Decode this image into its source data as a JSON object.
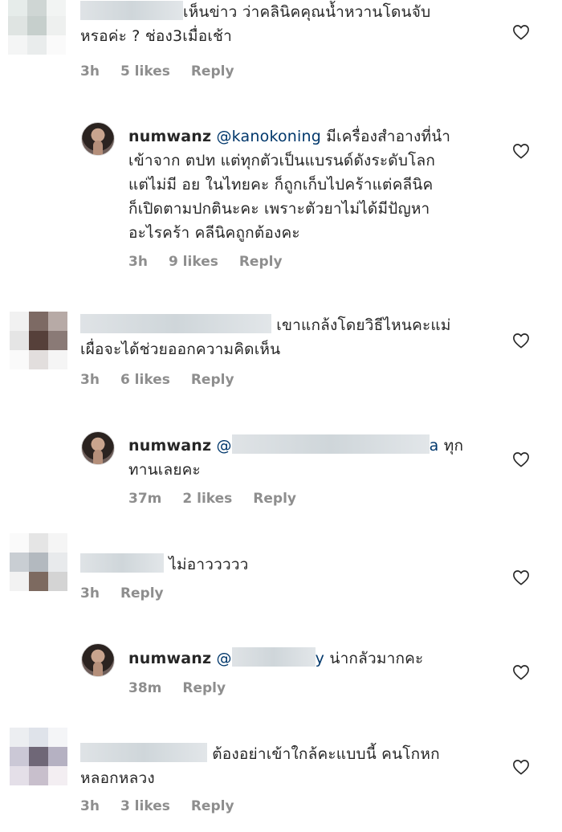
{
  "comments": [
    {
      "text_line1": "เห็นข่าว ว่าคลินิคคุณน้ำหวานโดนจับ",
      "text_line2": "หรอค่ะ ? ช่อง3เมื่อเช้า",
      "time": "3h",
      "likes": "5 likes",
      "reply": "Reply"
    },
    {
      "username": "numwanz",
      "mention": "@kanokoning",
      "text_line1_after_mention": "มีเครื่องสำอางที่นำ",
      "text_line2": "เข้าจาก ตปท แต่ทุกตัวเป็นแบรนด์ดังระดับโลก",
      "text_line3": "แต่ไม่มี อย ในไทยคะ ก็ถูกเก็บไปคร้าแต่คลีนิค",
      "text_line4": "ก็เปิดตามปกตินะคะ เพราะตัวยาไม่ได้มีปัญหา",
      "text_line5": "อะไรคร้า คลีนิคถูกต้องคะ",
      "time": "3h",
      "likes": "9 likes",
      "reply": "Reply"
    },
    {
      "username_partial": "pattawadeeunanttanaka",
      "text_line1": "เขาแกล้งโดยวิธีไหนคะแม่",
      "text_line2": "เผื่อจะได้ช่วยออกความคิดเห็น",
      "time": "3h",
      "likes": "6 likes",
      "reply": "Reply"
    },
    {
      "username": "numwanz",
      "mention_end": "a",
      "text_line1": "ทุก",
      "text_line2": "ทานเลยคะ",
      "time": "37m",
      "likes": "2 likes",
      "reply": "Reply"
    },
    {
      "text_line1": "ไม่อาววววว",
      "time": "3h",
      "reply": "Reply"
    },
    {
      "username": "numwanz",
      "mention_end": "y",
      "text_line1": "น่ากลัวมากคะ",
      "time": "38m",
      "reply": "Reply"
    },
    {
      "text_line1": "ต้องอย่าเข้าใกล้คะแบบนี้ คนโกหก",
      "text_line2": "หลอกหลวง",
      "time": "3h",
      "likes": "3 likes",
      "reply": "Reply"
    }
  ],
  "colors": {
    "text": "#262626",
    "meta": "#8e8e8e",
    "mention": "#00376b"
  },
  "icons": {
    "like": "heart-outline-icon"
  }
}
